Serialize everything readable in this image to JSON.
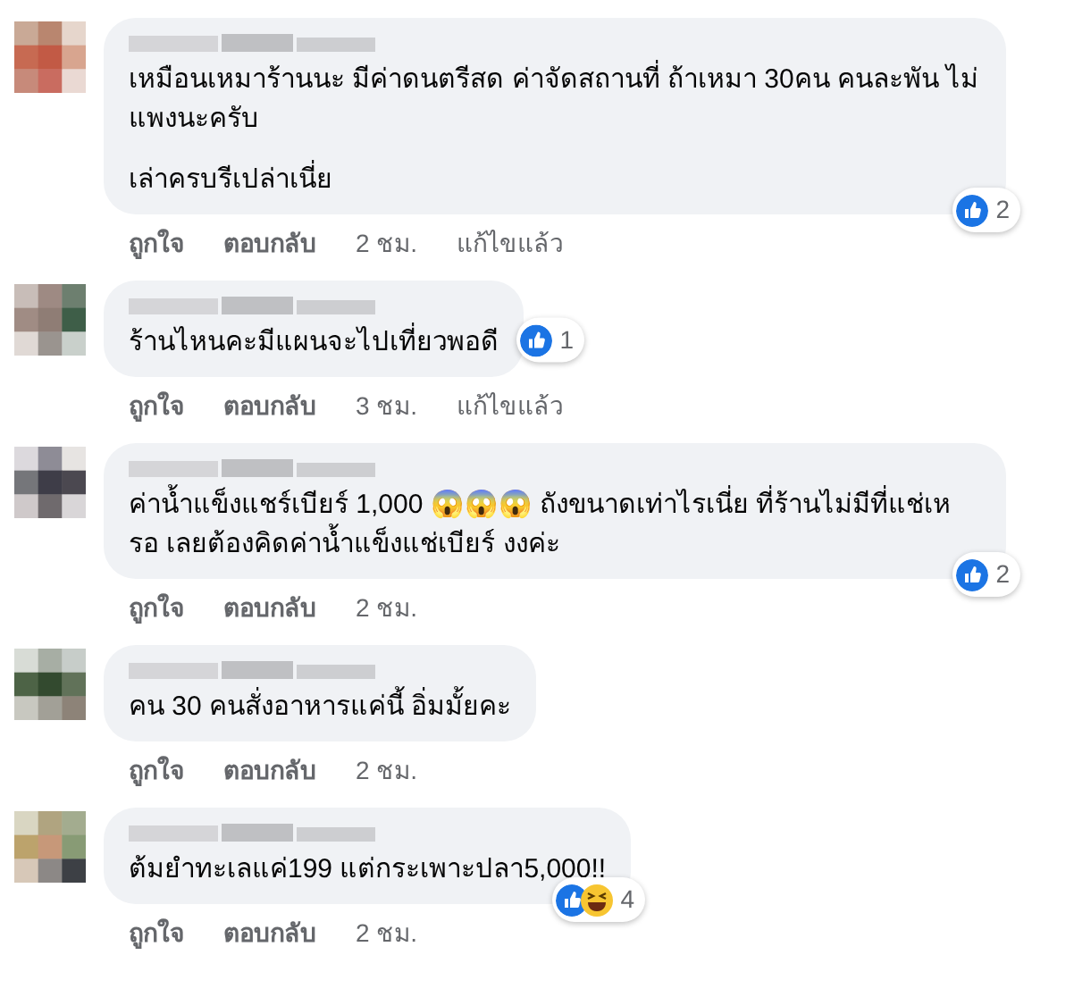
{
  "comments": [
    {
      "paragraphs": [
        "เหมือนเหมาร้านนะ มีค่าดนตรีสด ค่าจัดสถานที่ ถ้าเหมา 30คน คนละพัน ไม่แพงนะครับ",
        "เล่าครบรีเปล่าเนี่ย"
      ],
      "reactions": {
        "kind": "corner",
        "icons": [
          {
            "kind": "like"
          }
        ],
        "count": "2"
      },
      "actions": {
        "like": "ถูกใจ",
        "reply": "ตอบกลับ",
        "time": "2 ชม.",
        "edited": "แก้ไขแล้ว"
      }
    },
    {
      "paragraphs": [
        "ร้านไหนคะมีแผนจะไปเที่ยวพอดี"
      ],
      "reactions": {
        "kind": "inline",
        "icons": [
          {
            "kind": "like"
          }
        ],
        "count": "1"
      },
      "actions": {
        "like": "ถูกใจ",
        "reply": "ตอบกลับ",
        "time": "3 ชม.",
        "edited": "แก้ไขแล้ว"
      }
    },
    {
      "paragraphs": [
        "ค่าน้ำแข็งแชร์เบียร์ 1,000 😱😱😱 ถังขนาดเท่าไรเนี่ย ที่ร้านไม่มีที่แช่เหรอ เลยต้องคิดค่าน้ำแข็งแช่เบียร์ งงค่ะ"
      ],
      "reactions": {
        "kind": "corner",
        "icons": [
          {
            "kind": "like"
          }
        ],
        "count": "2"
      },
      "actions": {
        "like": "ถูกใจ",
        "reply": "ตอบกลับ",
        "time": "2 ชม."
      }
    },
    {
      "paragraphs": [
        "คน 30 คนสั่งอาหารแค่นี้ อิ่มมั้ยคะ"
      ],
      "actions": {
        "like": "ถูกใจ",
        "reply": "ตอบกลับ",
        "time": "2 ชม."
      }
    },
    {
      "paragraphs": [
        "ต้มยำทะเลแค่199 แต่กระเพาะปลา5,000!!"
      ],
      "reactions": {
        "kind": "corner",
        "icons": [
          {
            "kind": "like"
          },
          {
            "kind": "haha"
          }
        ],
        "count": "4"
      },
      "actions": {
        "like": "ถูกใจ",
        "reply": "ตอบกลับ",
        "time": "2 ชม."
      }
    }
  ]
}
